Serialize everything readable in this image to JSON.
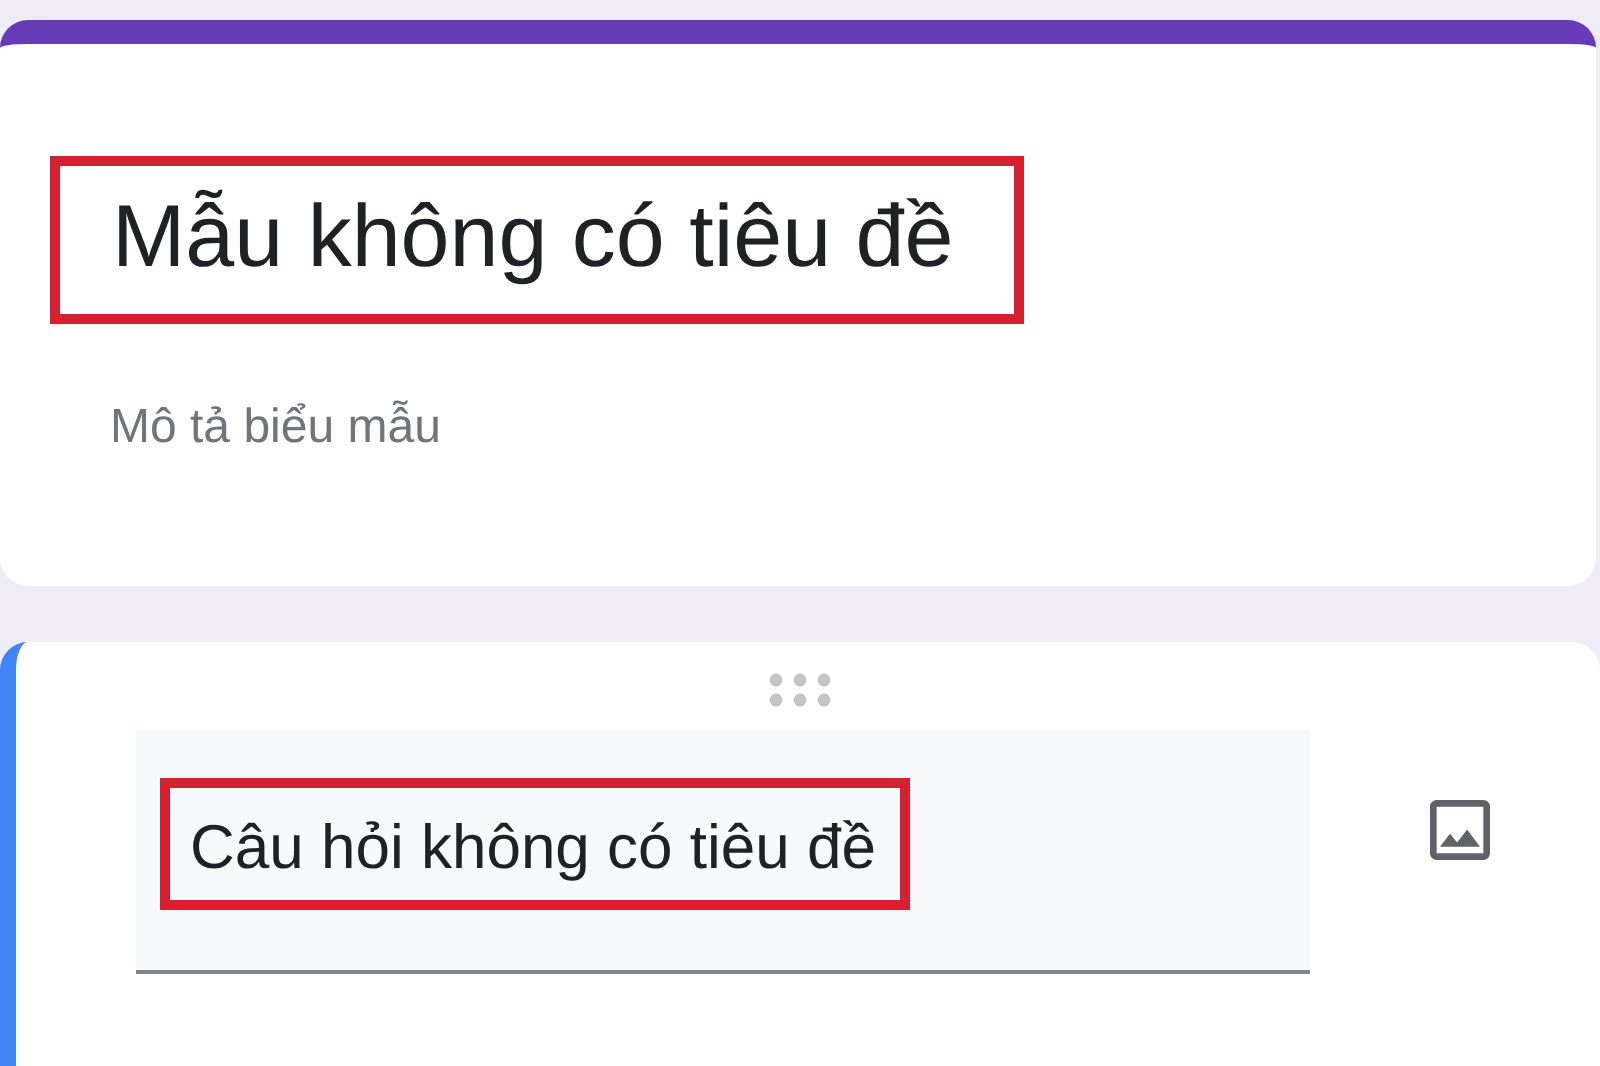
{
  "form_header": {
    "title": "Mẫu không có tiêu đề",
    "title_highlighted": true,
    "description_placeholder": "Mô tả biểu mẫu"
  },
  "question_card": {
    "active": true,
    "question_title": "Câu hỏi không có tiêu đề",
    "question_highlighted": true
  }
}
